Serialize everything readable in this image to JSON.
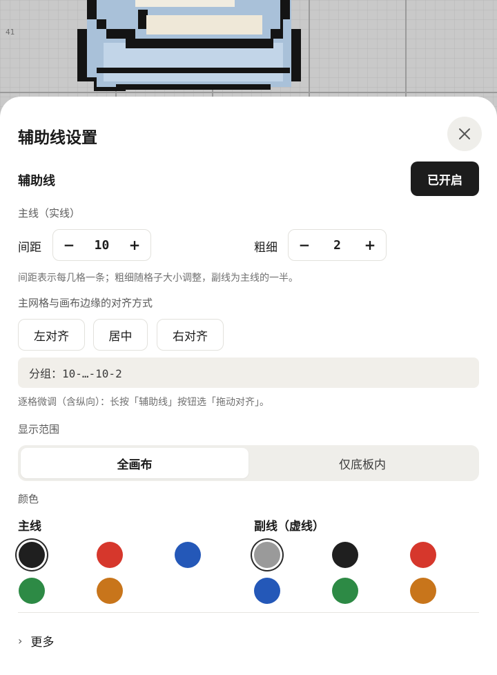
{
  "canvas": {
    "row_number": "41"
  },
  "panel": {
    "title": "辅助线设置",
    "close_icon": "close-icon",
    "guides_label": "辅助线",
    "guides_toggle": "已开启",
    "main_line_section": "主线（实线）",
    "spacing_label": "间距",
    "spacing_value": "10",
    "thickness_label": "粗细",
    "thickness_value": "2",
    "minus": "−",
    "plus": "+",
    "hint_spacing": "间距表示每几格一条；粗细随格子大小调整，副线为主线的一半。",
    "align_section": "主网格与画布边缘的对齐方式",
    "align_options": [
      "左对齐",
      "居中",
      "右对齐"
    ],
    "group_text": "分组：10-…-10-2",
    "hint_fine_tune": "逐格微调（含纵向）：长按「辅助线」按钮选「拖动对齐」。",
    "range_section": "显示范围",
    "range_options": [
      "全画布",
      "仅底板内"
    ],
    "range_selected": "全画布",
    "color_section": "颜色",
    "main_line_colors_label": "主线",
    "sub_line_colors_label": "副线（虚线）",
    "main_colors": [
      "#1f1f1f",
      "#d6372c",
      "#2458b8",
      "#2d8a45",
      "#c8751b"
    ],
    "main_selected": "#1f1f1f",
    "sub_colors": [
      "#9a9a9a",
      "#1f1f1f",
      "#d6372c",
      "#2458b8",
      "#2d8a45",
      "#c8751b"
    ],
    "sub_selected": "#9a9a9a",
    "more": "更多",
    "more_icon": "chevron-right-icon"
  }
}
